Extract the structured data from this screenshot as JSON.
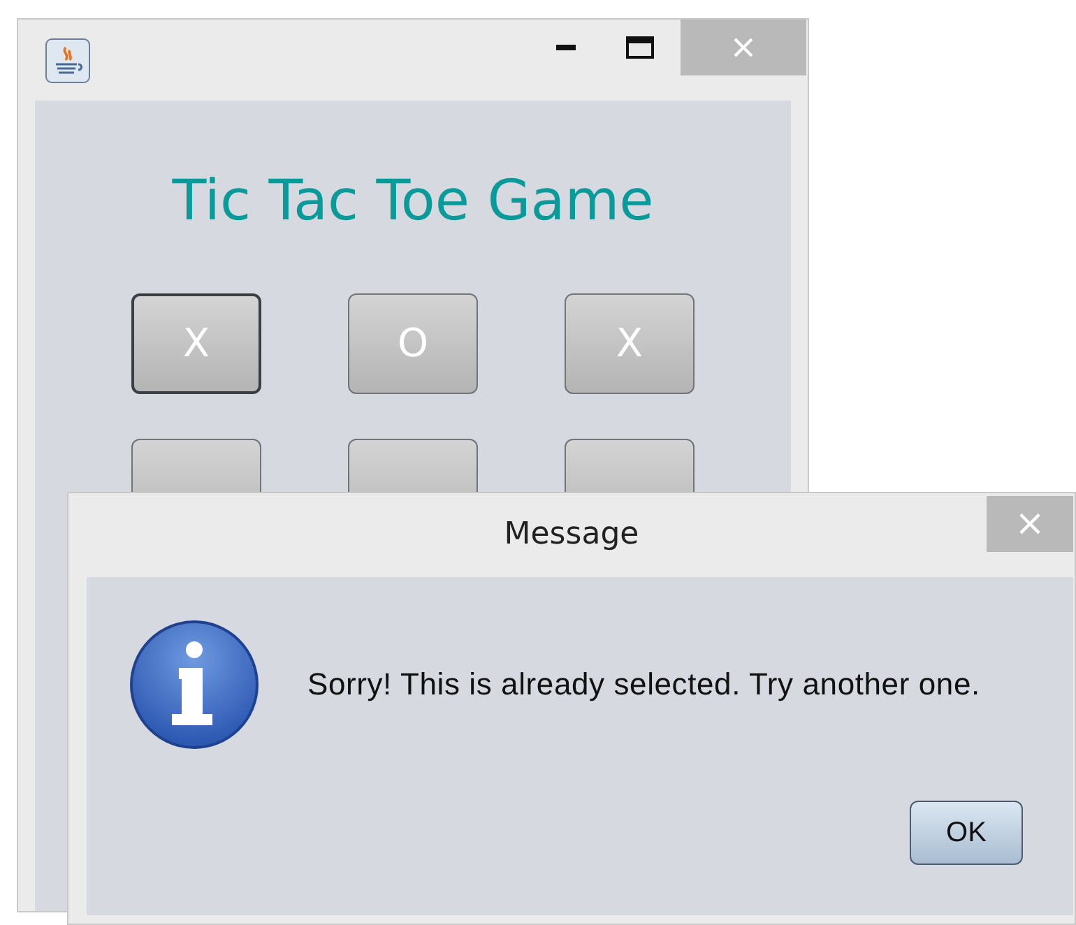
{
  "main_window": {
    "title_bar": {
      "buttons": [
        {
          "kind": "minimize"
        },
        {
          "kind": "maximize"
        },
        {
          "kind": "close"
        }
      ]
    },
    "heading": "Tic Tac Toe Game",
    "board": [
      {
        "mark": "X",
        "focused": true
      },
      {
        "mark": "O",
        "focused": false
      },
      {
        "mark": "X",
        "focused": false
      },
      {
        "focused": false
      },
      {
        "focused": false
      },
      {
        "focused": false
      }
    ]
  },
  "dialog": {
    "title": "Message",
    "close_label": "×",
    "message": "Sorry! This is already selected. Try another one.",
    "buttons": [
      "OK"
    ]
  }
}
